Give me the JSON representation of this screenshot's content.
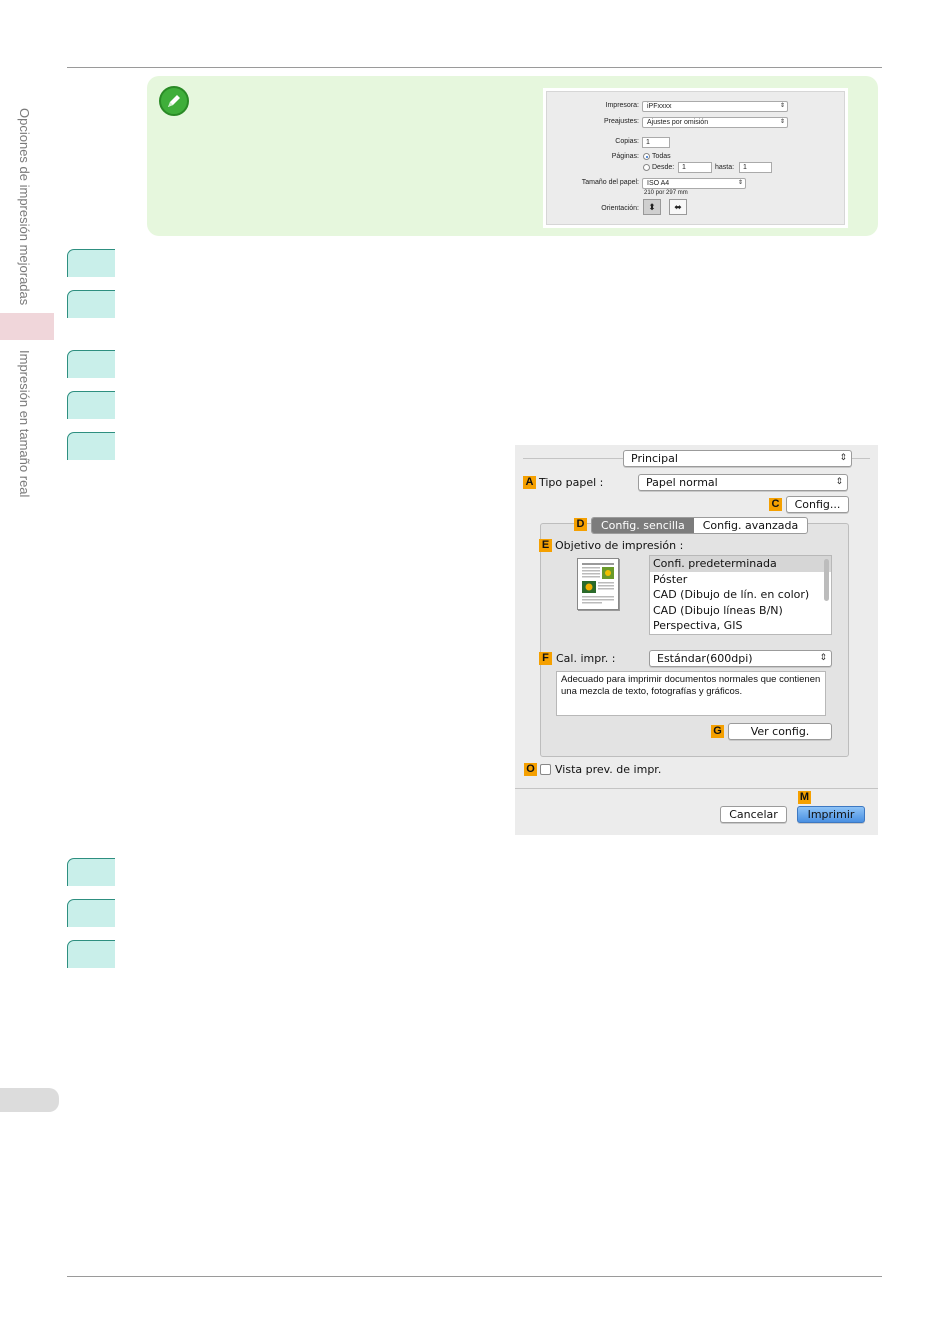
{
  "sidebar": {
    "chapter": "Opciones de impresión mejoradas",
    "section": "Impresión en tamaño real"
  },
  "note_dialog": {
    "printer_label": "Impresora:",
    "printer_value": "iPFxxxx",
    "presets_label": "Preajustes:",
    "presets_value": "Ajustes por omisión",
    "copies_label": "Copias:",
    "copies_value": "1",
    "pages_label": "Páginas:",
    "pages_all": "Todas",
    "pages_from": "Desde:",
    "pages_from_value": "1",
    "pages_to": "hasta:",
    "pages_to_value": "1",
    "paper_size_label": "Tamaño del papel:",
    "paper_size_value": "ISO A4",
    "paper_size_dims": "210 por 297 mm",
    "orientation_label": "Orientación:"
  },
  "dialog": {
    "panel_popup": "Principal",
    "tag_a": "A",
    "paper_type_label": "Tipo papel :",
    "paper_type_value": "Papel normal",
    "tag_c": "C",
    "config_button": "Config...",
    "tag_d": "D",
    "tabs": [
      "Config. sencilla",
      "Config. avanzada"
    ],
    "tag_e": "E",
    "purpose_label": "Objetivo de impresión :",
    "purpose_items": [
      "Confi. predeterminada",
      "Póster",
      "CAD (Dibujo de lín. en color)",
      "CAD (Dibujo líneas B/N)",
      "Perspectiva, GIS"
    ],
    "tag_f": "F",
    "quality_label": "Cal. impr. :",
    "quality_value": "Estándar(600dpi)",
    "description": "Adecuado para imprimir documentos normales que contienen una mezcla de texto, fotografías y gráficos.",
    "tag_g": "G",
    "view_settings_button": "Ver config.",
    "tag_o": "O",
    "preview_label": "Vista prev. de impr.",
    "tag_m": "M",
    "cancel_button": "Cancelar",
    "print_button": "Imprimir"
  },
  "colors": {
    "note_bg": "#e6f7dd",
    "step_tab": "#c9efea",
    "tag_orange": "#f5a000"
  }
}
